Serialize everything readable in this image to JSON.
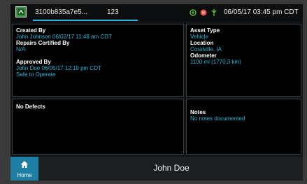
{
  "status_bar": {
    "app_icon": "document-icon",
    "vehicle_id": "3100b835a7e5...",
    "trailer_number": "123",
    "indicators": [
      {
        "icon": "gps-icon",
        "color": "#5cbf2a"
      },
      {
        "icon": "alert-icon",
        "color": "#e0534a"
      },
      {
        "icon": "signal-icon",
        "color": "#5cbf2a"
      }
    ],
    "datetime": "06/05/17 03:45 pm CDT"
  },
  "inspection": {
    "created_by_label": "Created By",
    "created_by_value": "John Johnson 06/02/17 11:48 am CDT",
    "repairs_certified_label": "Repairs Certified By",
    "repairs_certified_value": "N/A",
    "approved_by_label": "Approved By",
    "approved_by_value": "John Doe 06/05/17 12:19 pm CDT",
    "approved_status": "Safe to Operate"
  },
  "asset": {
    "type_label": "Asset Type",
    "type_value": "Vehicle",
    "location_label": "Location",
    "location_value": "Coralville, IA",
    "odometer_label": "Odometer",
    "odometer_value": "1100 mi (1770.3 km)"
  },
  "defects": {
    "title": "No Defects"
  },
  "notes": {
    "title": "Notes",
    "value": "No notes documented"
  },
  "bottom_bar": {
    "home_icon": "home-icon",
    "home_label": "Home",
    "driver_name": "John Doe"
  },
  "colors": {
    "accent": "#2bb3d8",
    "home_button": "#1e7ea3",
    "panel_bg": "#000000",
    "screen_bg": "#101417"
  }
}
